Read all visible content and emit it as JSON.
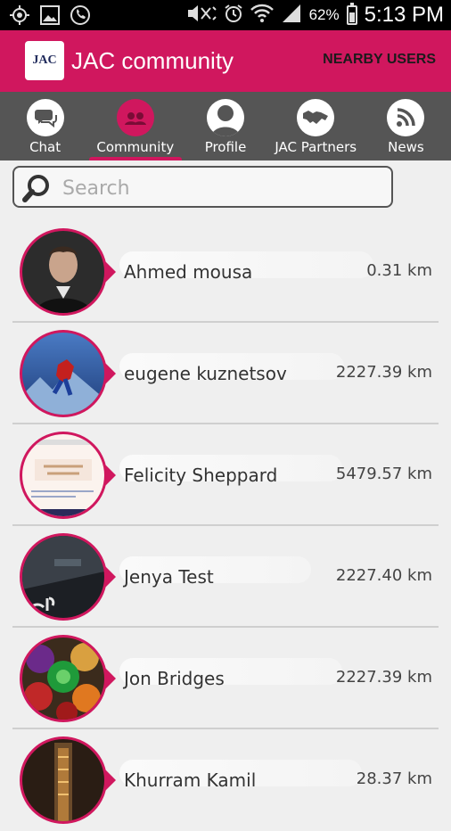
{
  "status_bar": {
    "battery_percent": "62%",
    "time": "5:13 PM",
    "icons": [
      "gps-icon",
      "image-icon",
      "phone-icon",
      "mute-icon",
      "alarm-icon",
      "wifi-icon",
      "signal-icon",
      "battery-icon"
    ]
  },
  "app_bar": {
    "logo_text": "JAC",
    "title": "JAC community",
    "nearby_label": "NEARBY USERS",
    "color": "#d0175e"
  },
  "tabs": [
    {
      "label": "Chat",
      "icon": "chat-icon",
      "active": false
    },
    {
      "label": "Community",
      "icon": "community-icon",
      "active": true
    },
    {
      "label": "Profile",
      "icon": "profile-icon",
      "active": false
    },
    {
      "label": "JAC Partners",
      "icon": "handshake-icon",
      "active": false
    },
    {
      "label": "News",
      "icon": "rss-icon",
      "active": false
    }
  ],
  "search": {
    "placeholder": "Search",
    "value": ""
  },
  "users": [
    {
      "name": "Ahmed mousa",
      "distance": "0.31 km",
      "avatar": "man-photo"
    },
    {
      "name": "eugene kuznetsov",
      "distance": "2227.39 km",
      "avatar": "spiderman-photo"
    },
    {
      "name": "Felicity Sheppard",
      "distance": "5479.57 km",
      "avatar": "document-photo"
    },
    {
      "name": "Jenya Test",
      "distance": "2227.40 km",
      "avatar": "device-photo"
    },
    {
      "name": "Jon Bridges",
      "distance": "2227.39 km",
      "avatar": "flowers-photo"
    },
    {
      "name": "Khurram Kamil",
      "distance": "28.37 km",
      "avatar": "tower-photo"
    }
  ]
}
